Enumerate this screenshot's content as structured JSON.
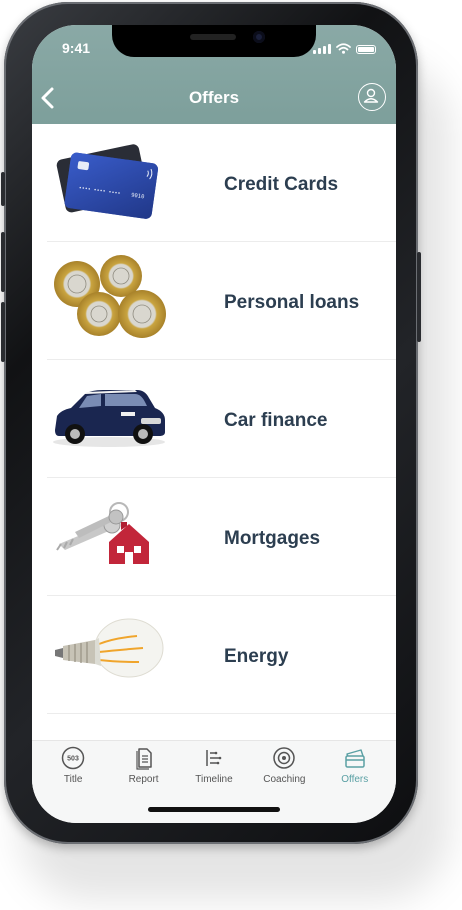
{
  "status_bar": {
    "time": "9:41"
  },
  "header": {
    "title": "Offers"
  },
  "offers": [
    {
      "label": "Credit Cards",
      "icon": "credit-card-image"
    },
    {
      "label": "Personal loans",
      "icon": "coins-image"
    },
    {
      "label": "Car finance",
      "icon": "car-image"
    },
    {
      "label": "Mortgages",
      "icon": "house-keys-image"
    },
    {
      "label": "Energy",
      "icon": "light-bulb-image"
    }
  ],
  "card_text": {
    "number": "9010"
  },
  "tabbar": {
    "tabs": [
      {
        "label": "Title",
        "icon": "score-icon",
        "score": "503"
      },
      {
        "label": "Report",
        "icon": "report-icon"
      },
      {
        "label": "Timeline",
        "icon": "timeline-icon"
      },
      {
        "label": "Coaching",
        "icon": "coaching-icon"
      },
      {
        "label": "Offers",
        "icon": "offers-icon",
        "active": true
      }
    ]
  },
  "colors": {
    "header": "#7d9f9b",
    "accent": "#5aa0a4",
    "label": "#2c3e50"
  }
}
